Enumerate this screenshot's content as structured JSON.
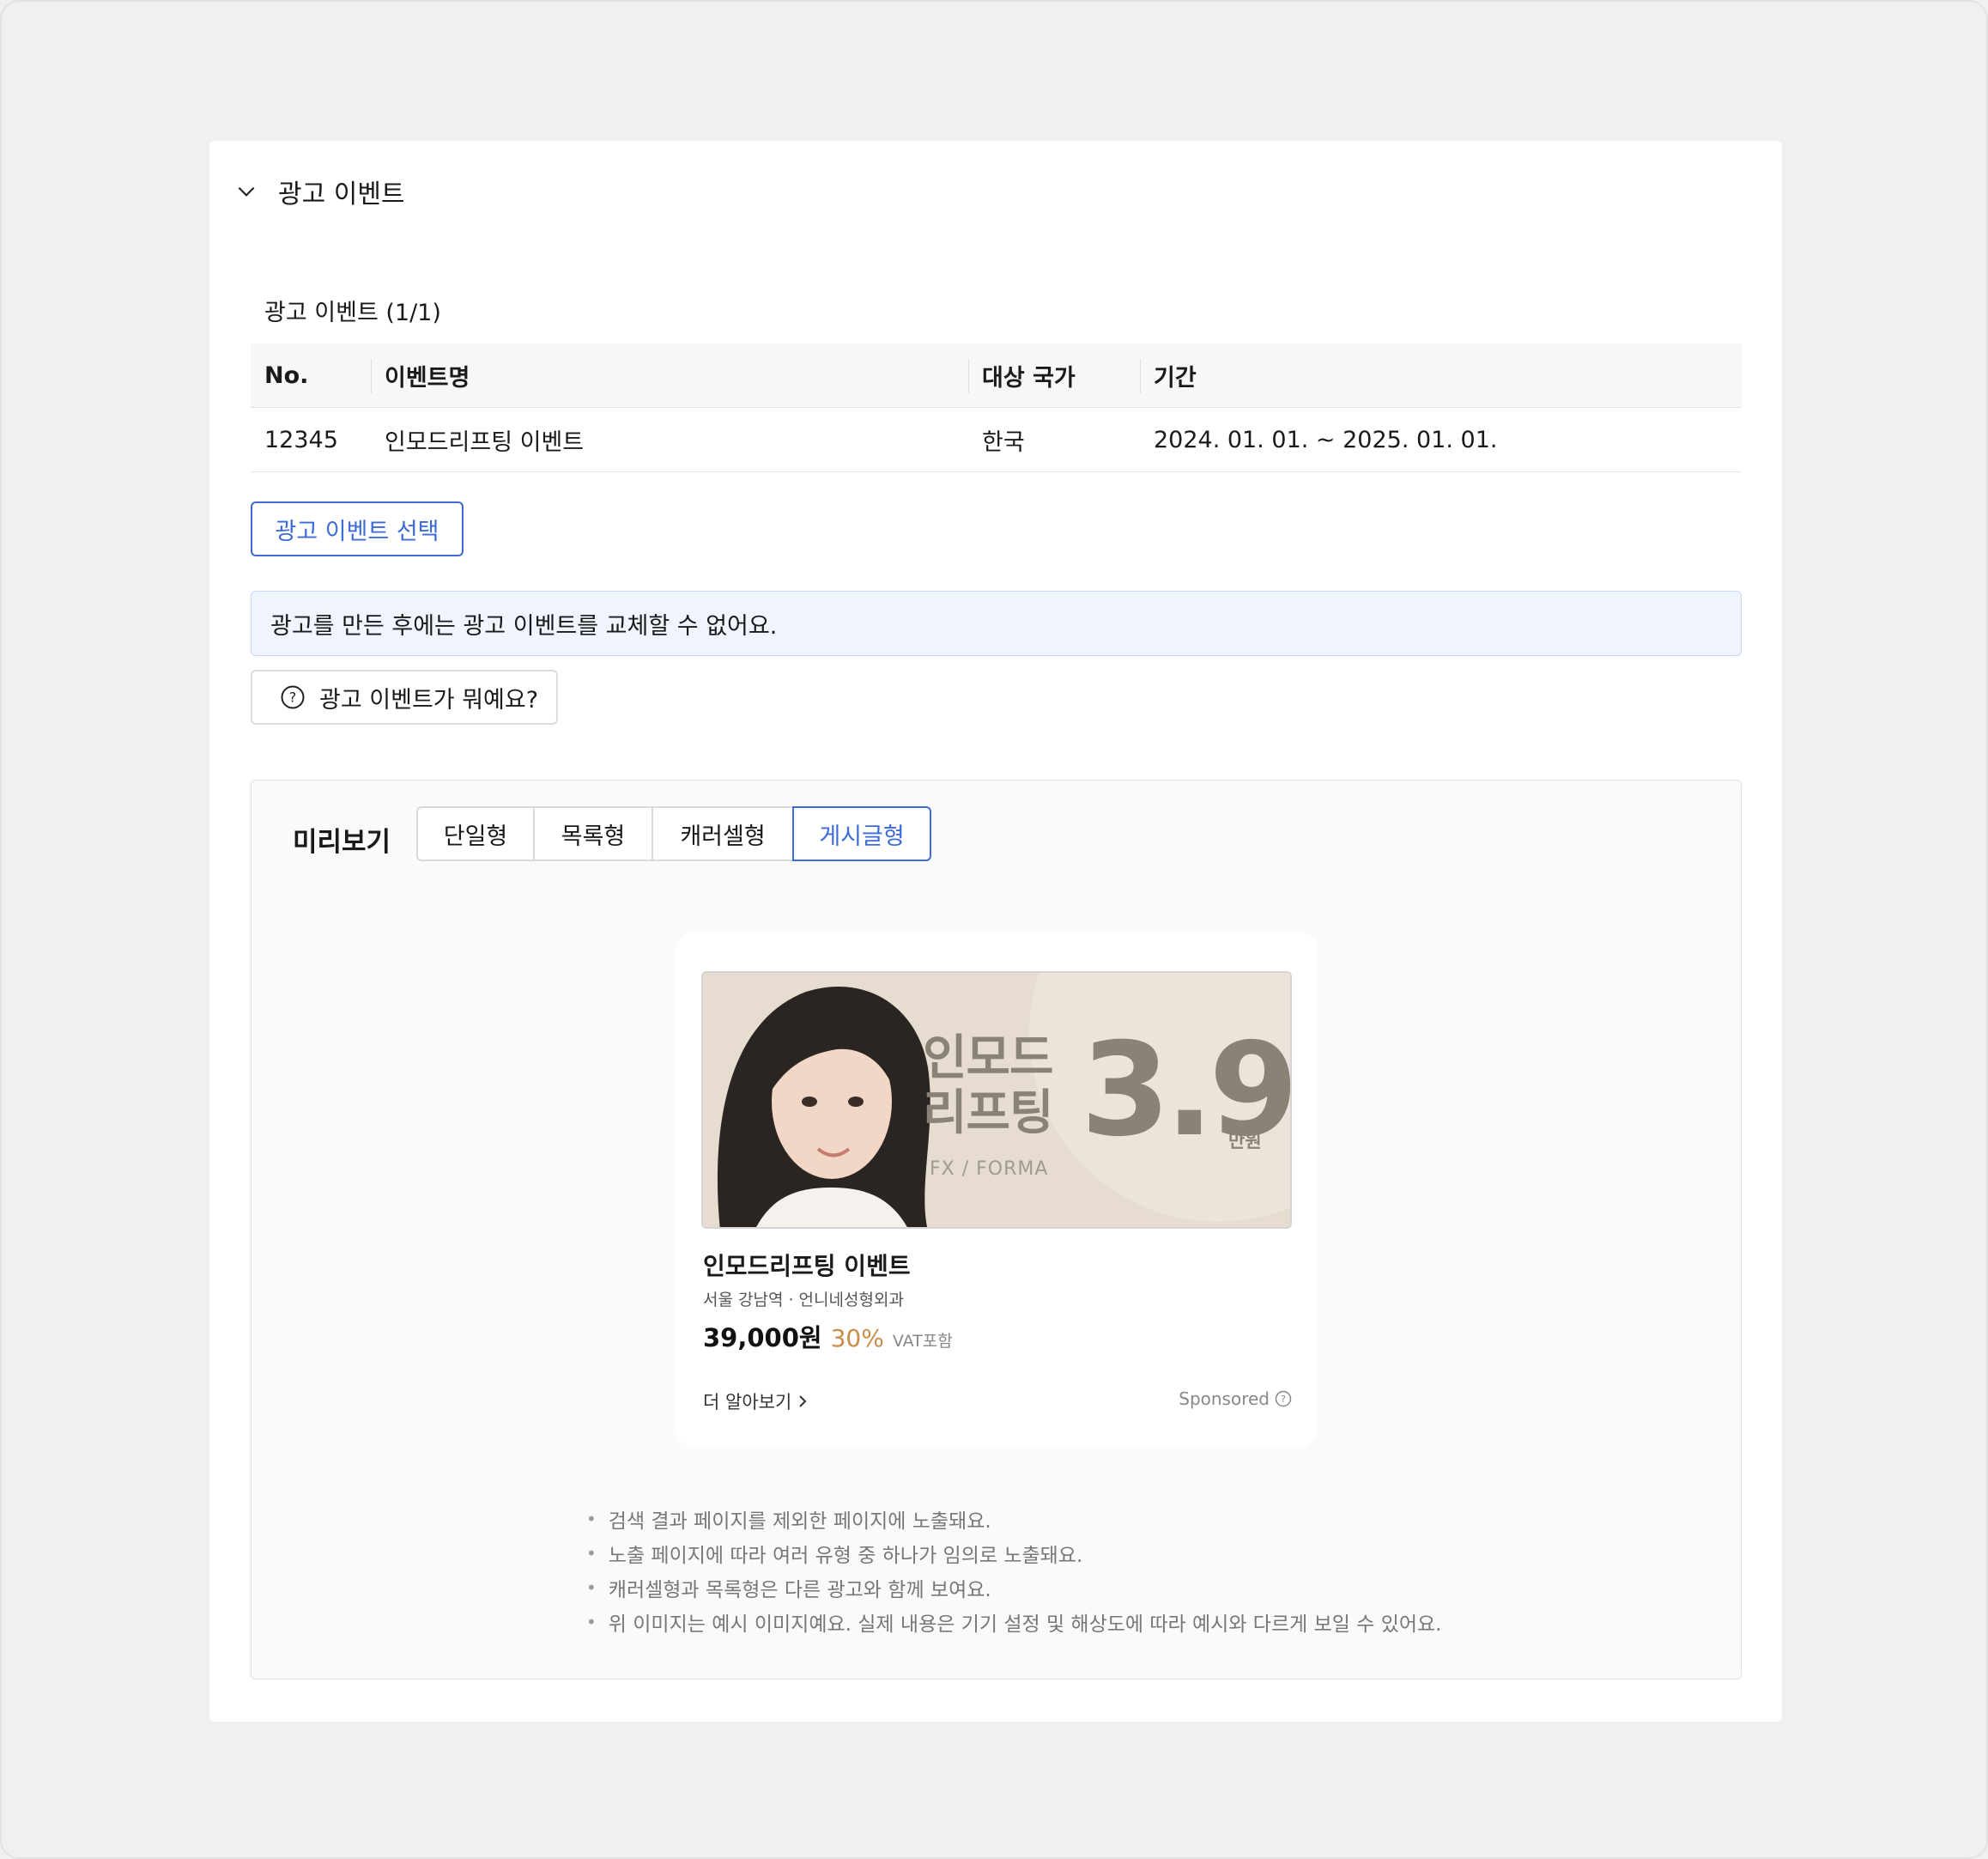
{
  "section": {
    "title": "광고 이벤트"
  },
  "table": {
    "caption": "광고 이벤트 (1/1)",
    "headers": [
      "No.",
      "이벤트명",
      "대상 국가",
      "기간"
    ],
    "rows": [
      [
        "12345",
        "인모드리프팅 이벤트",
        "한국",
        "2024. 01. 01. ~ 2025. 01. 01."
      ]
    ]
  },
  "actions": {
    "select_label": "광고 이벤트 선택",
    "notice": "광고를 만든 후에는 광고 이벤트를 교체할 수 없어요.",
    "help_label": "광고 이벤트가 뭐예요?"
  },
  "preview": {
    "label": "미리보기",
    "tabs": [
      "단일형",
      "목록형",
      "캐러셀형",
      "게시글형"
    ],
    "active_tab": "게시글형",
    "ad": {
      "banner_line1": "인모드",
      "banner_line2": "리프팅",
      "banner_price": "3.9",
      "banner_unit": "만원",
      "banner_brand": "FX / FORMA",
      "title": "인모드리프팅 이벤트",
      "location": "서울 강남역 · 언니네성형외과",
      "price": "39,000원",
      "discount": "30%",
      "vat": "VAT포함",
      "more": "더 알아보기",
      "sponsored": "Sponsored"
    },
    "notes": [
      "검색 결과 페이지를 제외한 페이지에 노출돼요.",
      "노출 페이지에 따라 여러 유형 중 하나가 임의로 노출돼요.",
      "캐러셀형과 목록형은 다른 광고와 함께 보여요.",
      "위 이미지는 예시 이미지예요. 실제 내용은 기기 설정 및 해상도에 따라 예시와 다르게 보일 수 있어요."
    ]
  },
  "colors": {
    "accent": "#3d6bd9",
    "notice_bg": "#eff4fd",
    "discount": "#c98c4a"
  }
}
